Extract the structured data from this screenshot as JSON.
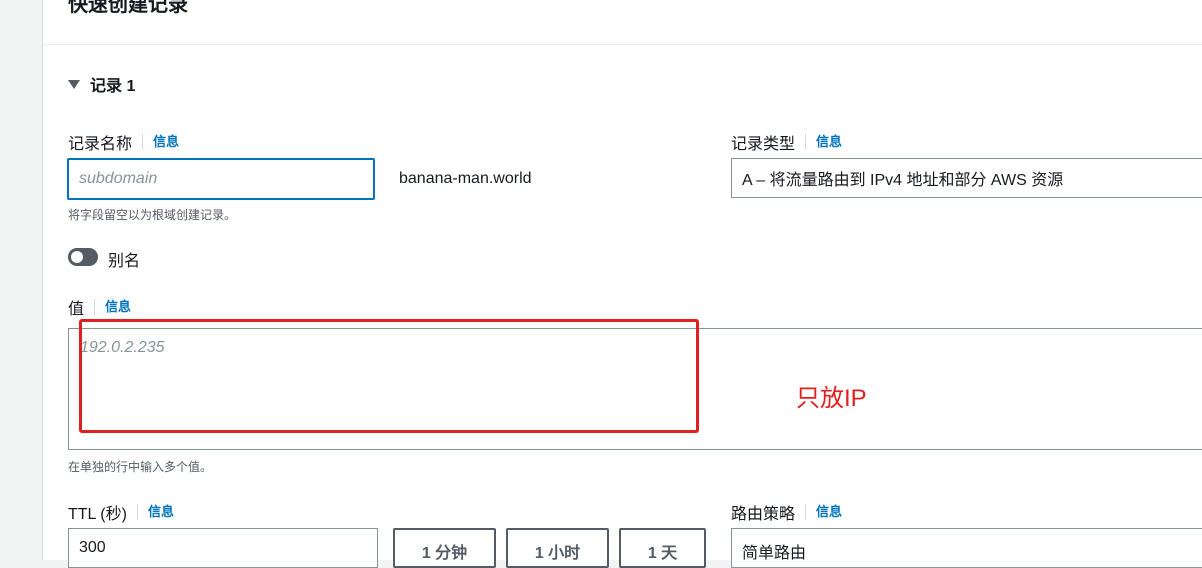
{
  "header": {
    "title": "快速创建记录"
  },
  "record": {
    "title": "记录 1"
  },
  "info_label": "信息",
  "record_name": {
    "label": "记录名称",
    "placeholder": "subdomain",
    "domain_suffix": "banana-man.world",
    "hint": "将字段留空以为根域创建记录。"
  },
  "record_type": {
    "label": "记录类型",
    "value": "A – 将流量路由到 IPv4 地址和部分 AWS 资源"
  },
  "alias": {
    "label": "别名",
    "enabled": false
  },
  "value": {
    "label": "值",
    "placeholder": "192.0.2.235",
    "hint": "在单独的行中输入多个值。"
  },
  "annotation": {
    "text": "只放IP",
    "color": "#e02020"
  },
  "ttl": {
    "label": "TTL (秒)",
    "value": "300",
    "buttons": [
      "1 分钟",
      "1 小时",
      "1 天"
    ]
  },
  "routing_policy": {
    "label": "路由策略",
    "value": "简单路由"
  },
  "colors": {
    "accent": "#0073bb",
    "border": "#879596",
    "annotation": "#e02020"
  }
}
